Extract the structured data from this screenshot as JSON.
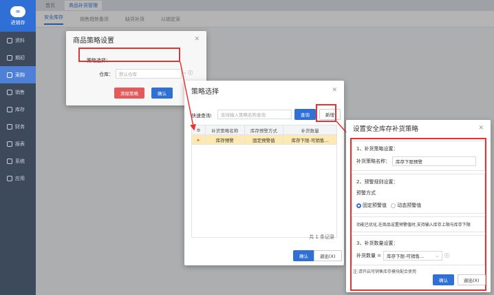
{
  "app": {
    "name": "进销存"
  },
  "sidebar": {
    "items": [
      {
        "label": "资料"
      },
      {
        "label": "期初"
      },
      {
        "label": "采购"
      },
      {
        "label": "销售"
      },
      {
        "label": "库存"
      },
      {
        "label": "财务"
      },
      {
        "label": "报表"
      },
      {
        "label": "系统"
      },
      {
        "label": "应用"
      }
    ]
  },
  "tabs": [
    {
      "label": "首页"
    },
    {
      "label": "商品补货管理"
    }
  ],
  "subtabs": [
    {
      "label": "安全库存"
    },
    {
      "label": "销售趋势备货"
    },
    {
      "label": "缺货补货"
    },
    {
      "label": "以销定采"
    }
  ],
  "dialog1": {
    "title": "商品策略设置",
    "strategy_label": "策略选择：",
    "warehouse_label": "仓库：",
    "warehouse_value": "默认仓库",
    "clear_button": "清除策略",
    "confirm_button": "确认"
  },
  "dialog2": {
    "title": "策略选择",
    "search_label": "快速查询:",
    "search_placeholder": "支持输入策略名称查询",
    "query_button": "查询",
    "new_button": "新增",
    "columns": [
      "补货策略名称",
      "库存预警方式",
      "补货数量"
    ],
    "rows": [
      {
        "name": "库存预警",
        "mode": "固定预警值",
        "qty": "库存下限-可销售..."
      }
    ],
    "footer": "共 1 条记录",
    "confirm_button": "确认",
    "exit_button": "退出(X)"
  },
  "dialog3": {
    "title": "设置安全库存补货策略",
    "s1_title": "1、补货策略设置：",
    "s1_label": "补货策略名称：",
    "s1_value": "库存下限预警",
    "s2_title": "2、预警规则设置：",
    "s2_label": "预警方式",
    "opt_fixed": "固定预警值",
    "opt_dynamic": "动态预警值",
    "note": "功能已优化,在商品设置预警值时,支持输入库存上限与库存下限",
    "s3_title": "3、补货数量设置：",
    "s3_label": "补货数量 =",
    "s3_value": "库存下限-可销售...",
    "footnote": "注:请开启可销售库存模块配合使用",
    "confirm_button": "确认",
    "exit_button": "退出(X)"
  },
  "colors": {
    "accent": "#2f6fd6",
    "highlight": "#e8322f"
  }
}
